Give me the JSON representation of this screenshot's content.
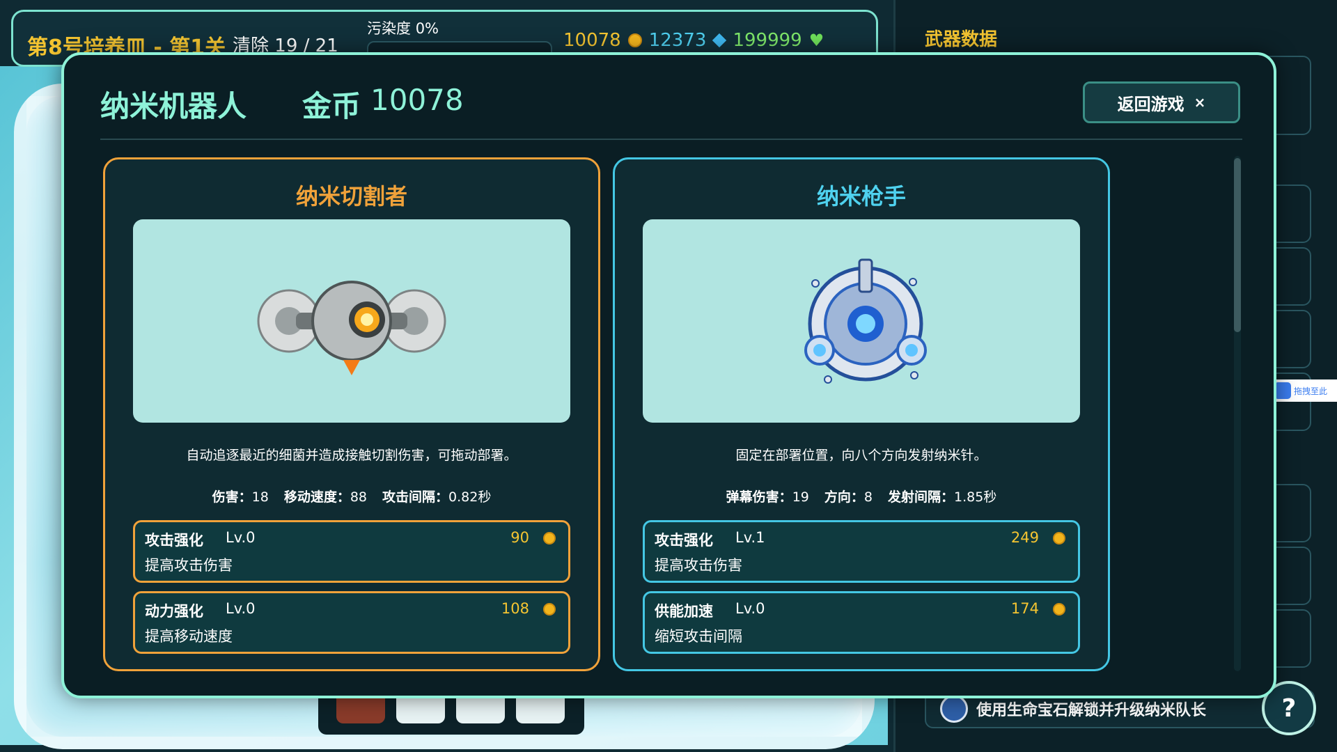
{
  "hud": {
    "level_title": "第8号培养皿 - 第1关",
    "clear_label": "清除",
    "clear_value": "19 / 21",
    "pollution_label": "污染度",
    "pollution_value": "0%",
    "gold": "10078",
    "diamonds": "12373",
    "life_gems": "199999"
  },
  "side_panel": {
    "title": "武器数据",
    "hint_text": "使用生命宝石解锁并升级纳米队长",
    "help_label": "?",
    "drag_label": "拖拽至此"
  },
  "modal": {
    "title": "纳米机器人",
    "gold_label": "金币",
    "gold_value": "10078",
    "back_label": "返回游戏",
    "close_glyph": "×"
  },
  "robots": [
    {
      "name": "纳米切割者",
      "description": "自动追逐最近的细菌并造成接触切割伤害，可拖动部署。",
      "stats": [
        {
          "label": "伤害：",
          "value": "18"
        },
        {
          "label": "移动速度：",
          "value": "88"
        },
        {
          "label": "攻击间隔：",
          "value": "0.82秒"
        }
      ],
      "upgrades": [
        {
          "name": "攻击强化",
          "level": "Lv.0",
          "desc": "提高攻击伤害",
          "cost": "90"
        },
        {
          "name": "动力强化",
          "level": "Lv.0",
          "desc": "提高移动速度",
          "cost": "108"
        }
      ]
    },
    {
      "name": "纳米枪手",
      "description": "固定在部署位置，向八个方向发射纳米针。",
      "stats": [
        {
          "label": "弹幕伤害：",
          "value": "19"
        },
        {
          "label": "方向：",
          "value": "8"
        },
        {
          "label": "发射间隔：",
          "value": "1.85秒"
        }
      ],
      "upgrades": [
        {
          "name": "攻击强化",
          "level": "Lv.1",
          "desc": "提高攻击伤害",
          "cost": "249"
        },
        {
          "name": "供能加速",
          "level": "Lv.0",
          "desc": "缩短攻击间隔",
          "cost": "174"
        }
      ]
    }
  ],
  "icons": {
    "gold": "coin-icon",
    "diamond": "diamond-icon",
    "life": "green-heart-icon",
    "cutter": "saw-robot-icon",
    "gunner": "turret-robot-icon"
  },
  "colors": {
    "accent": "#8ef2d8",
    "gold": "#f5c531",
    "orange": "#f0a23a",
    "blue": "#44c7e4"
  }
}
